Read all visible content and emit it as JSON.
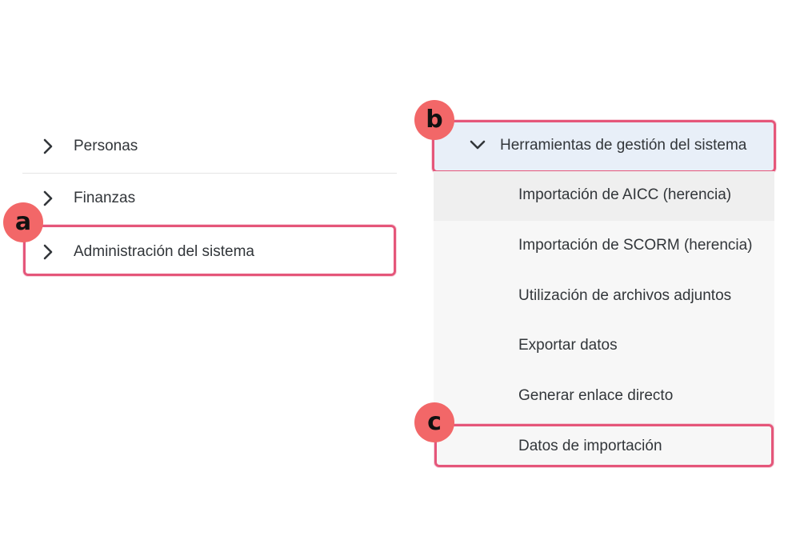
{
  "left_nav": {
    "items": [
      {
        "label": "Personas",
        "icon": "chevron-right-icon"
      },
      {
        "label": "Finanzas",
        "icon": "chevron-right-icon"
      },
      {
        "label": "Administración del sistema",
        "icon": "chevron-right-icon"
      }
    ]
  },
  "right_nav": {
    "group": {
      "label": "Herramientas de gestión del sistema",
      "icon": "chevron-down-icon",
      "expanded": true
    },
    "items": [
      {
        "label": "Importación de AICC (herencia)"
      },
      {
        "label": "Importación de SCORM (herencia)"
      },
      {
        "label": "Utilización de archivos adjuntos"
      },
      {
        "label": "Exportar datos"
      },
      {
        "label": "Generar enlace directo"
      },
      {
        "label": "Datos de importación"
      }
    ]
  },
  "annotations": {
    "a": "a",
    "b": "b",
    "c": "c"
  },
  "colors": {
    "highlight": "#e5567a",
    "badge": "#f26768",
    "selected_bg": "#e8eff8",
    "panel_bg": "#f7f7f7"
  }
}
